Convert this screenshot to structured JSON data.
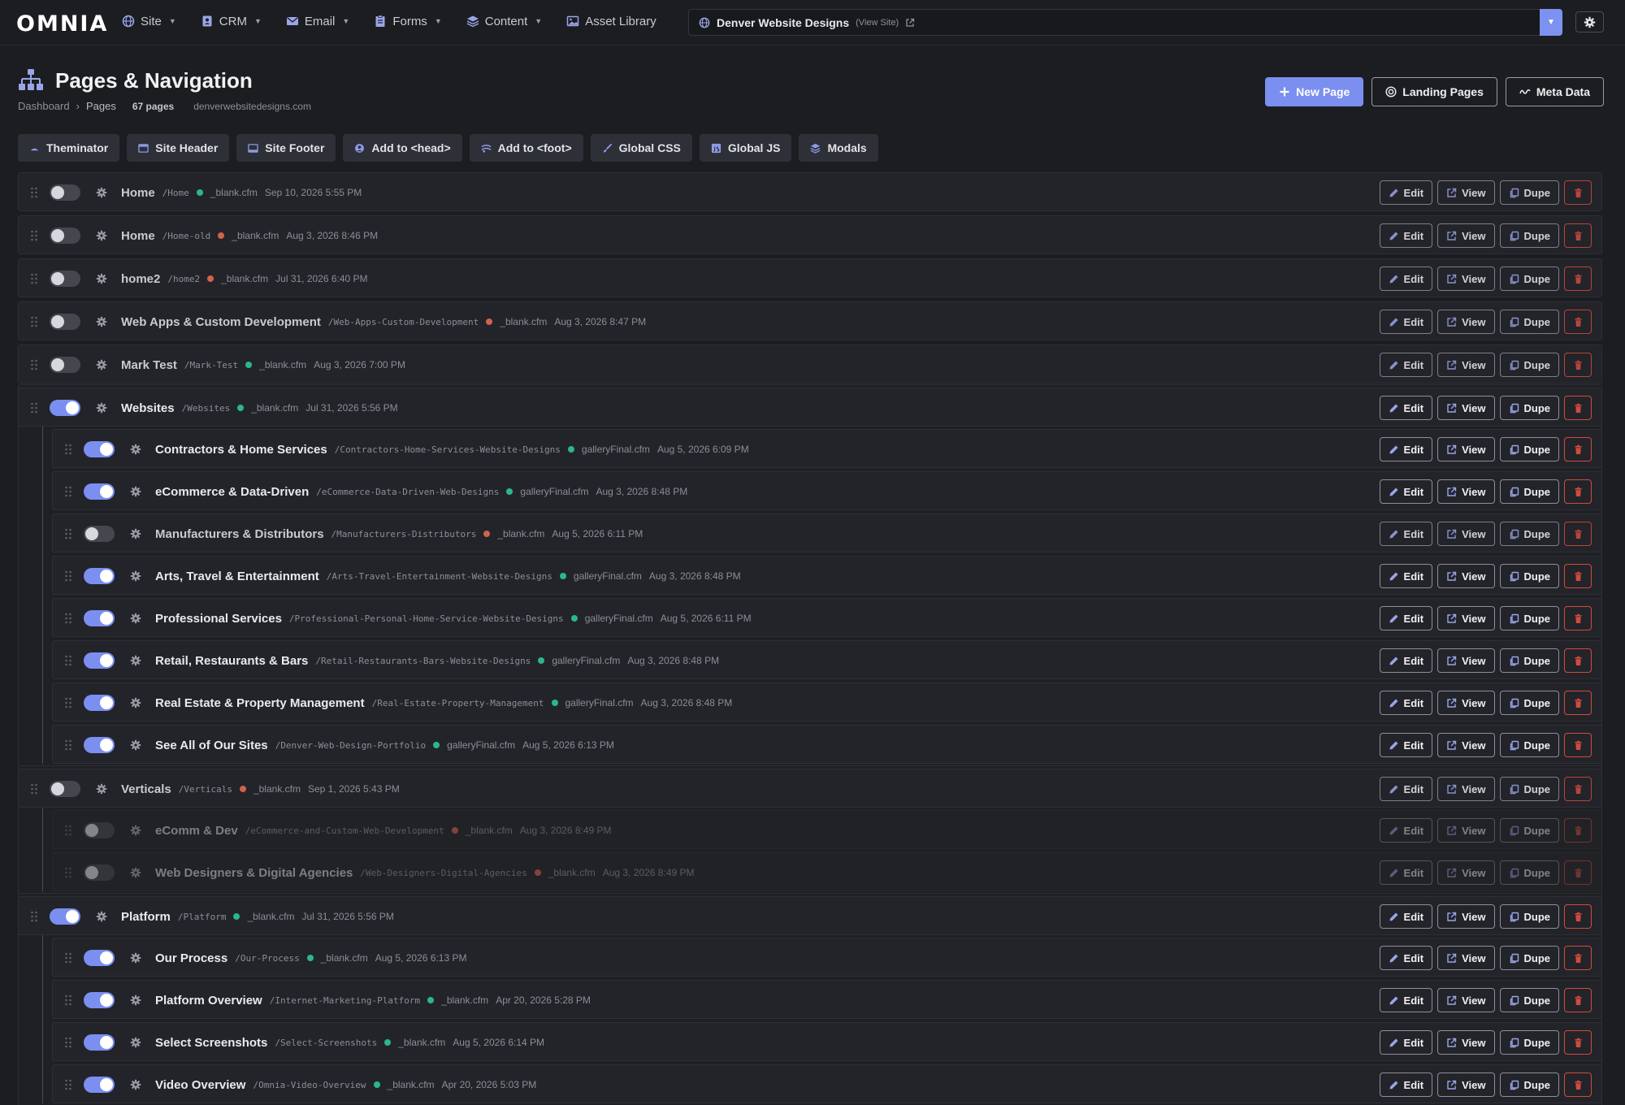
{
  "app": {
    "logo": "OMNIA",
    "nav": [
      {
        "label": "Site",
        "icon": "globe-icon"
      },
      {
        "label": "CRM",
        "icon": "contact-icon"
      },
      {
        "label": "Email",
        "icon": "envelope-icon"
      },
      {
        "label": "Forms",
        "icon": "form-icon"
      },
      {
        "label": "Content",
        "icon": "layers-icon"
      },
      {
        "label": "Asset Library",
        "icon": "image-icon"
      }
    ],
    "site_name": "Denver Website Designs",
    "view_site": "(View Site)"
  },
  "page": {
    "title": "Pages & Navigation",
    "breadcrumb": [
      "Dashboard",
      "Pages"
    ],
    "count": "67 pages",
    "domain": "denverwebsitedesigns.com",
    "buttons": {
      "new_page": "New Page",
      "landing_pages": "Landing Pages",
      "meta_data": "Meta Data"
    }
  },
  "toolbar": [
    {
      "label": "Theminator",
      "icon": "palette-icon"
    },
    {
      "label": "Site Header",
      "icon": "header-icon"
    },
    {
      "label": "Site Footer",
      "icon": "footer-icon"
    },
    {
      "label": "Add to <head>",
      "icon": "code-icon"
    },
    {
      "label": "Add to <foot>",
      "icon": "code-icon"
    },
    {
      "label": "Global CSS",
      "icon": "brush-icon"
    },
    {
      "label": "Global JS",
      "icon": "js-icon"
    },
    {
      "label": "Modals",
      "icon": "stack-icon"
    }
  ],
  "actions": {
    "edit": "Edit",
    "view": "View",
    "dupe": "Dupe"
  },
  "colors": {
    "accent": "#7b8ff0",
    "published": "#2ab78c",
    "unpublished": "#d1624d",
    "danger": "#d24a3d"
  },
  "pages": [
    {
      "title": "Home",
      "slug": "/Home",
      "status": "green",
      "template": "_blank.cfm",
      "date": "Sep 10, 2026 5:55 PM",
      "enabled": false,
      "level": 0
    },
    {
      "title": "Home",
      "slug": "/Home-old",
      "status": "red",
      "template": "_blank.cfm",
      "date": "Aug 3, 2026 8:46 PM",
      "enabled": false,
      "level": 0
    },
    {
      "title": "home2",
      "slug": "/home2",
      "status": "red",
      "template": "_blank.cfm",
      "date": "Jul 31, 2026 6:40 PM",
      "enabled": false,
      "level": 0
    },
    {
      "title": "Web Apps & Custom Development",
      "slug": "/Web-Apps-Custom-Development",
      "status": "red",
      "template": "_blank.cfm",
      "date": "Aug 3, 2026 8:47 PM",
      "enabled": false,
      "level": 0
    },
    {
      "title": "Mark Test",
      "slug": "/Mark-Test",
      "status": "green",
      "template": "_blank.cfm",
      "date": "Aug 3, 2026 7:00 PM",
      "enabled": false,
      "level": 0
    },
    {
      "title": "Websites",
      "slug": "/Websites",
      "status": "green",
      "template": "_blank.cfm",
      "date": "Jul 31, 2026 5:56 PM",
      "enabled": true,
      "level": 0
    },
    {
      "title": "Contractors & Home Services",
      "slug": "/Contractors-Home-Services-Website-Designs",
      "status": "green",
      "template": "galleryFinal.cfm",
      "date": "Aug 5, 2026 6:09 PM",
      "enabled": true,
      "level": 1
    },
    {
      "title": "eCommerce & Data-Driven",
      "slug": "/eCommerce-Data-Driven-Web-Designs",
      "status": "green",
      "template": "galleryFinal.cfm",
      "date": "Aug 3, 2026 8:48 PM",
      "enabled": true,
      "level": 1
    },
    {
      "title": "Manufacturers & Distributors",
      "slug": "/Manufacturers-Distributors",
      "status": "red",
      "template": "_blank.cfm",
      "date": "Aug 5, 2026 6:11 PM",
      "enabled": false,
      "level": 1
    },
    {
      "title": "Arts, Travel & Entertainment",
      "slug": "/Arts-Travel-Entertainment-Website-Designs",
      "status": "green",
      "template": "galleryFinal.cfm",
      "date": "Aug 3, 2026 8:48 PM",
      "enabled": true,
      "level": 1
    },
    {
      "title": "Professional Services",
      "slug": "/Professional-Personal-Home-Service-Website-Designs",
      "status": "green",
      "template": "galleryFinal.cfm",
      "date": "Aug 5, 2026 6:11 PM",
      "enabled": true,
      "level": 1
    },
    {
      "title": "Retail, Restaurants & Bars",
      "slug": "/Retail-Restaurants-Bars-Website-Designs",
      "status": "green",
      "template": "galleryFinal.cfm",
      "date": "Aug 3, 2026 8:48 PM",
      "enabled": true,
      "level": 1
    },
    {
      "title": "Real Estate & Property Management",
      "slug": "/Real-Estate-Property-Management",
      "status": "green",
      "template": "galleryFinal.cfm",
      "date": "Aug 3, 2026 8:48 PM",
      "enabled": true,
      "level": 1
    },
    {
      "title": "See All of Our Sites",
      "slug": "/Denver-Web-Design-Portfolio",
      "status": "green",
      "template": "galleryFinal.cfm",
      "date": "Aug 5, 2026 6:13 PM",
      "enabled": true,
      "level": 1
    },
    {
      "title": "Verticals",
      "slug": "/Verticals",
      "status": "red",
      "template": "_blank.cfm",
      "date": "Sep 1, 2026 5:43 PM",
      "enabled": false,
      "level": 0
    },
    {
      "title": "eComm & Dev",
      "slug": "/eCommerce-and-Custom-Web-Development",
      "status": "red",
      "template": "_blank.cfm",
      "date": "Aug 3, 2026 8:49 PM",
      "enabled": false,
      "level": 1
    },
    {
      "title": "Web Designers & Digital Agencies",
      "slug": "/Web-Designers-Digital-Agencies",
      "status": "red",
      "template": "_blank.cfm",
      "date": "Aug 3, 2026 8:49 PM",
      "enabled": false,
      "level": 1
    },
    {
      "title": "Platform",
      "slug": "/Platform",
      "status": "green",
      "template": "_blank.cfm",
      "date": "Jul 31, 2026 5:56 PM",
      "enabled": true,
      "level": 0
    },
    {
      "title": "Our Process",
      "slug": "/Our-Process",
      "status": "green",
      "template": "_blank.cfm",
      "date": "Aug 5, 2026 6:13 PM",
      "enabled": true,
      "level": 1
    },
    {
      "title": "Platform Overview",
      "slug": "/Internet-Marketing-Platform",
      "status": "green",
      "template": "_blank.cfm",
      "date": "Apr 20, 2026 5:28 PM",
      "enabled": true,
      "level": 1
    },
    {
      "title": "Select Screenshots",
      "slug": "/Select-Screenshots",
      "status": "green",
      "template": "_blank.cfm",
      "date": "Aug 5, 2026 6:14 PM",
      "enabled": true,
      "level": 1
    },
    {
      "title": "Video Overview",
      "slug": "/Omnia-Video-Overview",
      "status": "green",
      "template": "_blank.cfm",
      "date": "Apr 20, 2026 5:03 PM",
      "enabled": true,
      "level": 1
    }
  ]
}
